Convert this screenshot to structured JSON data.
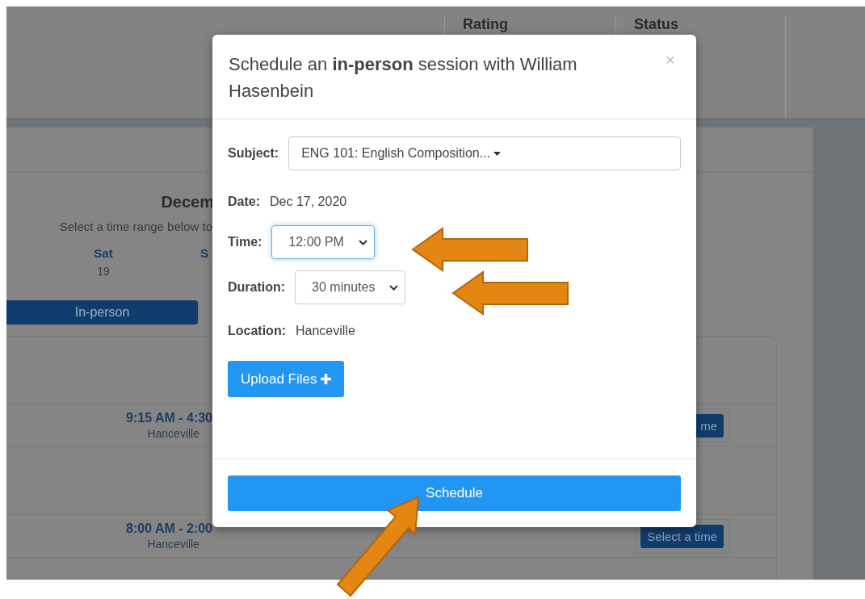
{
  "background": {
    "header_columns": [
      "Rating",
      "Status"
    ],
    "month_heading": "Decem",
    "instruction": "Select a time range below to",
    "day_columns": [
      {
        "weekday": "Sat",
        "date": "19"
      },
      {
        "weekday": "S"
      }
    ],
    "mode_button": "In-person",
    "slots": [
      {
        "time": "9:15 AM - 4:30",
        "location": "Hanceville",
        "button": "me"
      },
      {
        "time": "8:00 AM - 2:00",
        "location": "Hanceville",
        "button": "Select a time"
      }
    ]
  },
  "modal": {
    "title": "Schedule an **in-person** session with William Hasenbein",
    "close": "×",
    "fields": [
      {
        "kind": "dropdown",
        "label": "Subject:",
        "value": "ENG 101: English Composition..."
      },
      {
        "kind": "text",
        "label": "Date:",
        "value": "Dec 17, 2020"
      },
      {
        "kind": "select",
        "label": "Time:",
        "value": "12:00 PM",
        "focused": true
      },
      {
        "kind": "select",
        "label": "Duration:",
        "value": "30 minutes",
        "focused": false
      },
      {
        "kind": "text",
        "label": "Location:",
        "value": "Hanceville"
      }
    ],
    "upload_button": "Upload Files",
    "submit_button": "Schedule"
  }
}
